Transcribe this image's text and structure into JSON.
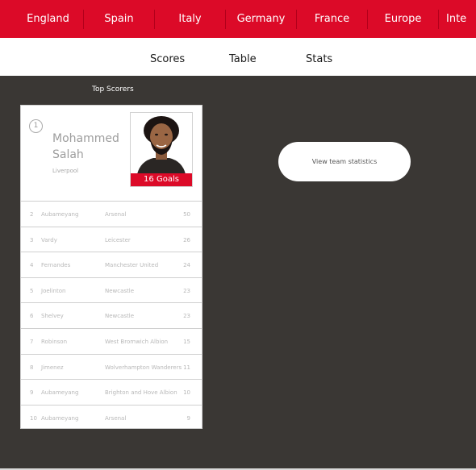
{
  "top_nav": {
    "leagues": [
      "England",
      "Spain",
      "Italy",
      "Germany",
      "France",
      "Europe",
      "Inte"
    ]
  },
  "sub_nav": {
    "tabs": [
      "Scores",
      "Table",
      "Stats"
    ]
  },
  "top_scorers": {
    "title": "Top Scorers",
    "leader": {
      "rank": "1",
      "first_name": "Mohammed",
      "last_name": "Salah",
      "club": "Liverpool",
      "goals_label": "16 Goals"
    },
    "rows": [
      {
        "rank": "2",
        "player": "Aubameyang",
        "club": "Arsenal",
        "goals": "50"
      },
      {
        "rank": "3",
        "player": "Vardy",
        "club": "Leicester",
        "goals": "26"
      },
      {
        "rank": "4",
        "player": "Fernandes",
        "club": "Manchester United",
        "goals": "24"
      },
      {
        "rank": "5",
        "player": "Joelinton",
        "club": "Newcastle",
        "goals": "23"
      },
      {
        "rank": "6",
        "player": "Shelvey",
        "club": "Newcastle",
        "goals": "23"
      },
      {
        "rank": "7",
        "player": "Robinson",
        "club": "West Bromwich Albion",
        "goals": "15"
      },
      {
        "rank": "8",
        "player": "Jimenez",
        "club": "Wolverhampton Wanderers",
        "goals": "11"
      },
      {
        "rank": "9",
        "player": "Aubameyang",
        "club": "Brighton and Hove Albion",
        "goals": "10"
      },
      {
        "rank": "10",
        "player": "Aubameyang",
        "club": "Arsenal",
        "goals": "9"
      }
    ]
  },
  "actions": {
    "view_team_stats": "View team statistics"
  },
  "colors": {
    "brand_red": "#dc0a28",
    "background": "#3a3734"
  }
}
